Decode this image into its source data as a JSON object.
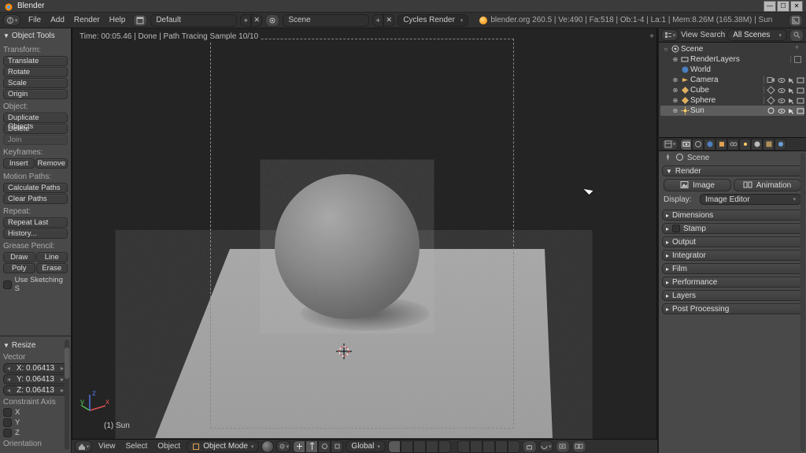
{
  "app": {
    "title": "Blender"
  },
  "info_header": {
    "menus": [
      "File",
      "Add",
      "Render",
      "Help"
    ],
    "layout": "Default",
    "scene": "Scene",
    "engine": "Cycles Render",
    "stats": "blender.org 260.5 | Ve:490 | Fa:518 | Ob:1-4 | La:1 | Mem:8.26M (165.38M) | Sun"
  },
  "tool_panel": {
    "title": "Object Tools",
    "sections": {
      "transform": {
        "label": "Transform:",
        "items": [
          "Translate",
          "Rotate",
          "Scale",
          "Origin"
        ]
      },
      "object": {
        "label": "Object:",
        "items": [
          "Duplicate Objects",
          "Delete",
          "Join"
        ]
      },
      "keyframes": {
        "label": "Keyframes:",
        "row": [
          "Insert",
          "Remove"
        ]
      },
      "motion": {
        "label": "Motion Paths:",
        "items": [
          "Calculate Paths",
          "Clear Paths"
        ]
      },
      "repeat": {
        "label": "Repeat:",
        "items": [
          "Repeat Last",
          "History..."
        ]
      },
      "grease": {
        "label": "Grease Pencil:",
        "rows": [
          [
            "Draw",
            "Line"
          ],
          [
            "Poly",
            "Erase"
          ]
        ],
        "check": "Use Sketching S"
      }
    }
  },
  "operator_panel": {
    "title": "Resize",
    "vector_label": "Vector",
    "values": [
      "X: 0.06413",
      "Y: 0.06413",
      "Z: 0.06413"
    ],
    "constraint_label": "Constraint Axis",
    "axes": [
      "X",
      "Y",
      "Z"
    ],
    "orientation_label": "Orientation"
  },
  "viewport": {
    "render_info": "Time: 00:05.46 | Done | Path Tracing Sample 10/10",
    "selected": "(1) Sun"
  },
  "view_header": {
    "menus": [
      "View",
      "Select",
      "Object"
    ],
    "mode": "Object Mode",
    "orientation": "Global"
  },
  "outliner": {
    "menus": [
      "View",
      "Search"
    ],
    "scope": "All Scenes",
    "tree": {
      "scene": "Scene",
      "renderlayers": "RenderLayers",
      "world": "World",
      "camera": "Camera",
      "cube": "Cube",
      "sphere": "Sphere",
      "sun": "Sun"
    }
  },
  "properties": {
    "datablock": "Scene",
    "render": {
      "title": "Render",
      "image": "Image",
      "animation": "Animation",
      "display_label": "Display:",
      "display_value": "Image Editor"
    },
    "panels": [
      "Dimensions",
      "Stamp",
      "Output",
      "Integrator",
      "Film",
      "Performance",
      "Layers",
      "Post Processing"
    ],
    "panel_checkbox": {
      "Stamp": true
    }
  }
}
